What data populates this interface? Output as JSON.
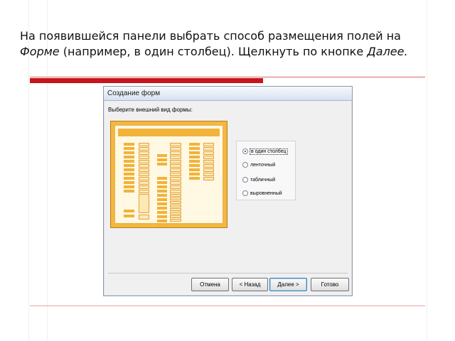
{
  "slide": {
    "caption_part1": "На появившейся панели выбрать способ размещения полей на ",
    "caption_form": "Форме",
    "caption_part2": " (например, в один столбец). Щелкнуть по кнопке ",
    "caption_next": "Далее."
  },
  "dialog": {
    "title": "Создание форм",
    "heading": "Выберите внешний вид формы:",
    "layout_options": [
      {
        "label": "в один столбец",
        "selected": true
      },
      {
        "label": "ленточный",
        "selected": false
      },
      {
        "label": "табличный",
        "selected": false
      },
      {
        "label": "выровненный",
        "selected": false
      }
    ],
    "buttons": {
      "cancel": "Отмена",
      "back": "< Назад",
      "next": "Далее >",
      "finish": "Готово"
    }
  },
  "colors": {
    "accent_red": "#c8141c",
    "preview_orange": "#f2b33a",
    "preview_field": "#fde9b5"
  }
}
